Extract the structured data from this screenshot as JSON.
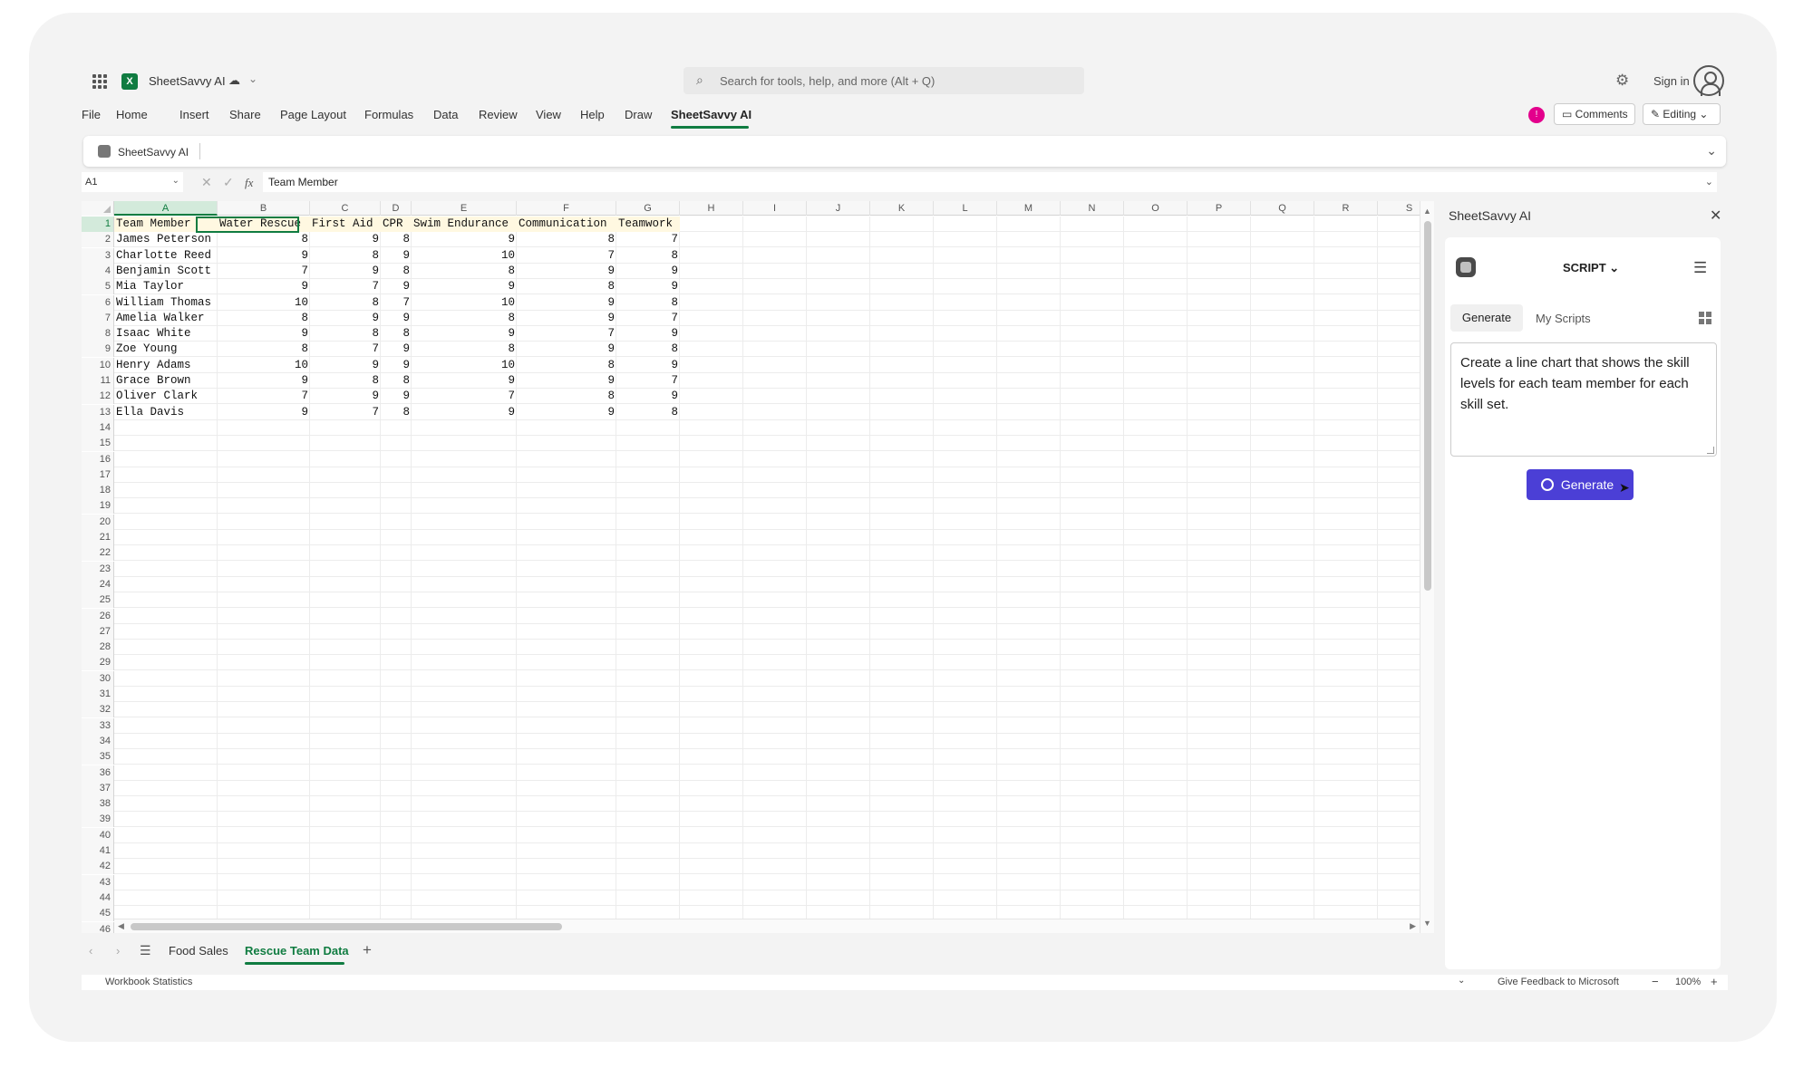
{
  "title_bar": {
    "app_name": "SheetSavvy AI",
    "search_placeholder": "Search for tools, help, and more (Alt + Q)",
    "sign_in": "Sign in"
  },
  "menu": {
    "items": [
      "File",
      "Home",
      "Insert",
      "Share",
      "Page Layout",
      "Formulas",
      "Data",
      "Review",
      "View",
      "Help",
      "Draw",
      "SheetSavvy AI"
    ],
    "active": "SheetSavvy AI",
    "comments": "Comments",
    "editing": "Editing",
    "notification_badge": "!"
  },
  "ribbon": {
    "addin_name": "SheetSavvy AI"
  },
  "formula_bar": {
    "name_box": "A1",
    "value": "Team Member"
  },
  "grid": {
    "columns": [
      "A",
      "B",
      "C",
      "D",
      "E",
      "F",
      "G",
      "H",
      "I",
      "J",
      "K",
      "L",
      "M",
      "N",
      "O",
      "P",
      "Q",
      "R",
      "S"
    ],
    "header_row": [
      "Team Member",
      "Water Rescue",
      "First Aid",
      "CPR",
      "Swim Endurance",
      "Communication",
      "Teamwork"
    ],
    "data_rows": [
      [
        "James Peterson",
        8,
        9,
        8,
        9,
        8,
        7
      ],
      [
        "Charlotte Reed",
        9,
        8,
        9,
        10,
        7,
        8
      ],
      [
        "Benjamin Scott",
        7,
        9,
        8,
        8,
        9,
        9
      ],
      [
        "Mia Taylor",
        9,
        7,
        9,
        9,
        8,
        9
      ],
      [
        "William Thomas",
        10,
        8,
        7,
        10,
        9,
        8
      ],
      [
        "Amelia Walker",
        8,
        9,
        9,
        8,
        9,
        7
      ],
      [
        "Isaac White",
        9,
        8,
        8,
        9,
        7,
        9
      ],
      [
        "Zoe Young",
        8,
        7,
        9,
        8,
        9,
        8
      ],
      [
        "Henry Adams",
        10,
        9,
        9,
        10,
        8,
        9
      ],
      [
        "Grace Brown",
        9,
        8,
        8,
        9,
        9,
        7
      ],
      [
        "Oliver Clark",
        7,
        9,
        9,
        7,
        8,
        9
      ],
      [
        "Ella Davis",
        9,
        7,
        8,
        9,
        9,
        8
      ]
    ],
    "visible_row_count": 46
  },
  "sheet_tabs": {
    "tabs": [
      "Food Sales",
      "Rescue Team Data"
    ],
    "active": "Rescue Team Data"
  },
  "status_bar": {
    "left": "Workbook Statistics",
    "feedback": "Give Feedback to Microsoft",
    "zoom": "100%"
  },
  "panel": {
    "title": "SheetSavvy AI",
    "mode": "SCRIPT",
    "tabs": [
      "Generate",
      "My Scripts"
    ],
    "prompt": "Create a line chart that shows the skill levels for each team member for each skill set.",
    "generate_button": "Generate"
  },
  "colors": {
    "excel_green": "#107c41",
    "generate_button": "#4b3fd6",
    "badge": "#e3008c"
  }
}
